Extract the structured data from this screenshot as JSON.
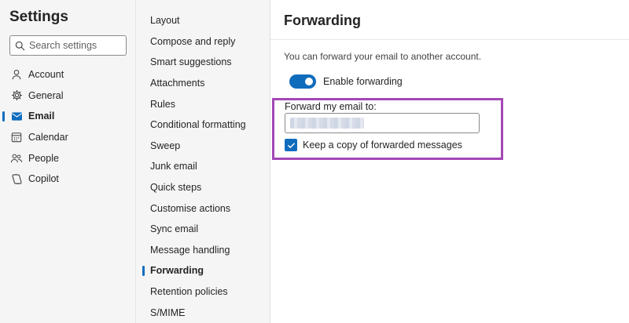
{
  "settings": {
    "title": "Settings",
    "search": {
      "placeholder": "Search settings",
      "value": ""
    },
    "categories": [
      {
        "label": "Account",
        "icon": "person-icon"
      },
      {
        "label": "General",
        "icon": "gear-icon"
      },
      {
        "label": "Email",
        "icon": "mail-icon",
        "active": true
      },
      {
        "label": "Calendar",
        "icon": "calendar-icon"
      },
      {
        "label": "People",
        "icon": "people-icon"
      },
      {
        "label": "Copilot",
        "icon": "copilot-icon"
      }
    ]
  },
  "email_nav": {
    "items": [
      {
        "label": "Layout"
      },
      {
        "label": "Compose and reply"
      },
      {
        "label": "Smart suggestions"
      },
      {
        "label": "Attachments"
      },
      {
        "label": "Rules"
      },
      {
        "label": "Conditional formatting"
      },
      {
        "label": "Sweep"
      },
      {
        "label": "Junk email"
      },
      {
        "label": "Quick steps"
      },
      {
        "label": "Customise actions"
      },
      {
        "label": "Sync email"
      },
      {
        "label": "Message handling"
      },
      {
        "label": "Forwarding",
        "active": true
      },
      {
        "label": "Retention policies"
      },
      {
        "label": "S/MIME"
      }
    ]
  },
  "forwarding": {
    "title": "Forwarding",
    "description": "You can forward your email to another account.",
    "enable_toggle": {
      "label": "Enable forwarding",
      "on": true
    },
    "forward_to": {
      "label": "Forward my email to:",
      "value_redacted": true
    },
    "keep_copy": {
      "label": "Keep a copy of forwarded messages",
      "checked": true
    }
  },
  "colors": {
    "accent": "#0f6cbd",
    "highlight_border": "#a347b5",
    "pane_background": "#f5f5f5"
  }
}
